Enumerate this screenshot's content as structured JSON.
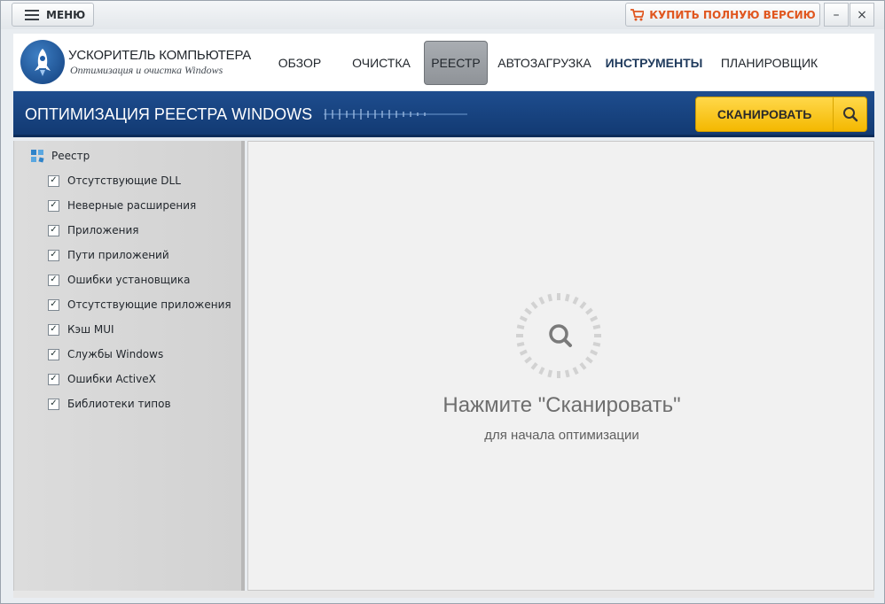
{
  "titlebar": {
    "menu_label": "МЕНЮ",
    "buy_label": "КУПИТЬ ПОЛНУЮ ВЕРСИЮ",
    "minimize_symbol": "–",
    "close_symbol": "×"
  },
  "header": {
    "app_title": "УСКОРИТЕЛЬ КОМПЬЮТЕРА",
    "app_subtitle": "Оптимизация и очистка Windows",
    "nav": [
      {
        "label": "ОБЗОР"
      },
      {
        "label": "ОЧИСТКА"
      },
      {
        "label": "РЕЕСТР",
        "active": true
      },
      {
        "label": "АВТОЗАГРУЗКА"
      },
      {
        "label": "ИНСТРУМЕНТЫ",
        "bold": true
      },
      {
        "label": "ПЛАНИРОВЩИК"
      }
    ]
  },
  "band": {
    "title": "ОПТИМИЗАЦИЯ РЕЕСТРА WINDOWS",
    "scan_label": "СКАНИРОВАТЬ"
  },
  "sidebar": {
    "root_label": "Реестр",
    "items": [
      {
        "label": "Отсутствующие DLL",
        "checked": true
      },
      {
        "label": "Неверные расширения",
        "checked": true
      },
      {
        "label": "Приложения",
        "checked": true
      },
      {
        "label": "Пути приложений",
        "checked": true
      },
      {
        "label": "Ошибки установщика",
        "checked": true
      },
      {
        "label": "Отсутствующие приложения",
        "checked": true
      },
      {
        "label": "Кэш MUI",
        "checked": true
      },
      {
        "label": "Службы Windows",
        "checked": true
      },
      {
        "label": "Ошибки ActiveX",
        "checked": true
      },
      {
        "label": "Библиотеки типов",
        "checked": true
      }
    ]
  },
  "main": {
    "prompt": "Нажмите \"Сканировать\"",
    "prompt_sub": "для начала оптимизации"
  },
  "colors": {
    "accent_orange": "#e0561f",
    "band_blue": "#1e4d8e",
    "scan_yellow": "#f4b800"
  }
}
